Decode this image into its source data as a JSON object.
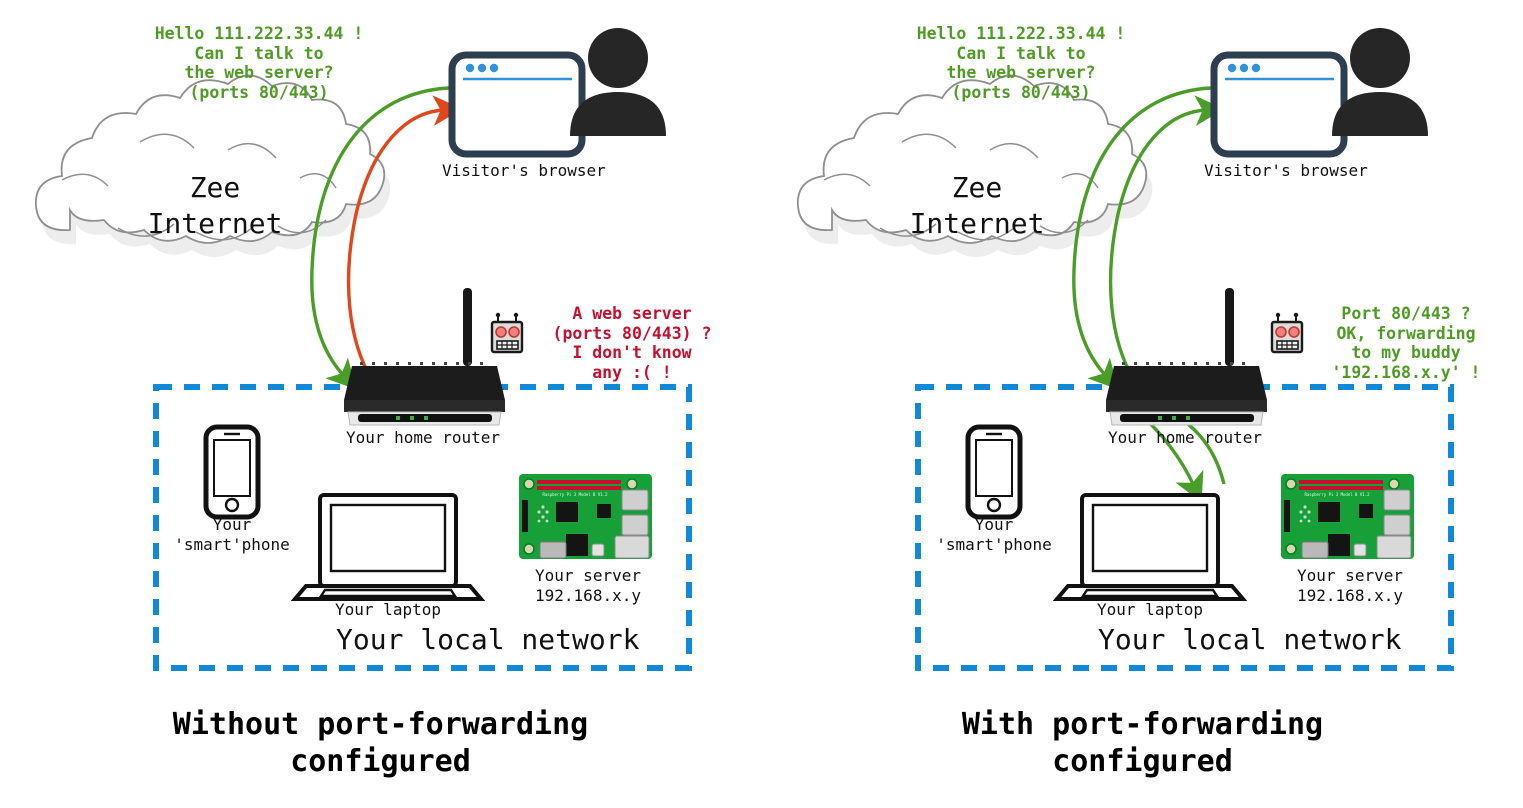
{
  "diagram": {
    "title_left": "Without port-forwarding\nconfigured",
    "title_right": "With port-forwarding\nconfigured",
    "colors": {
      "green": "#4f9c25",
      "arrow_green": "#4a9e28",
      "red": "#c8102e",
      "arrow_red": "#e2471b",
      "network_box_blue": "#1189d8",
      "browser_frame": "#2c3e50",
      "browser_accent": "#2e93d9",
      "cloud_outline": "#8f8f8f",
      "cloud_shadow": "#ededed",
      "router_body": "#1c1c1c",
      "pi_board": "#17a038",
      "text": "#111111"
    }
  },
  "left_panel": {
    "request_bubble": "Hello 111.222.33.44 !\nCan I talk to\nthe web server?\n(ports 80/443)",
    "response_bubble": "A web server\n(ports 80/443) ?\nI don't know\nany :( !",
    "cloud_label": "Zee\nInternet",
    "browser_label": "Visitor's browser",
    "router_label": "Your home router",
    "phone_label": "Your\n'smart'phone",
    "laptop_label": "Your laptop",
    "server_label": "Your server\n192.168.x.y",
    "network_label": "Your local network",
    "caption": "Without port-forwarding\nconfigured"
  },
  "right_panel": {
    "request_bubble": "Hello 111.222.33.44 !\nCan I talk to\nthe web server?\n(ports 80/443)",
    "response_bubble": "Port 80/443 ?\nOK, forwarding\nto my buddy\n'192.168.x.y' !",
    "cloud_label": "Zee\nInternet",
    "browser_label": "Visitor's browser",
    "router_label": "Your home router",
    "phone_label": "Your\n'smart'phone",
    "laptop_label": "Your laptop",
    "server_label": "Your server\n192.168.x.y",
    "network_label": "Your local network",
    "caption": "With port-forwarding\nconfigured"
  },
  "icons": {
    "cloud": "cloud-icon",
    "browser_window": "browser-window-icon",
    "person": "person-icon",
    "router": "router-icon",
    "robot": "robot-icon",
    "smartphone": "smartphone-icon",
    "laptop": "laptop-icon",
    "raspberry_pi": "raspberry-pi-icon"
  }
}
